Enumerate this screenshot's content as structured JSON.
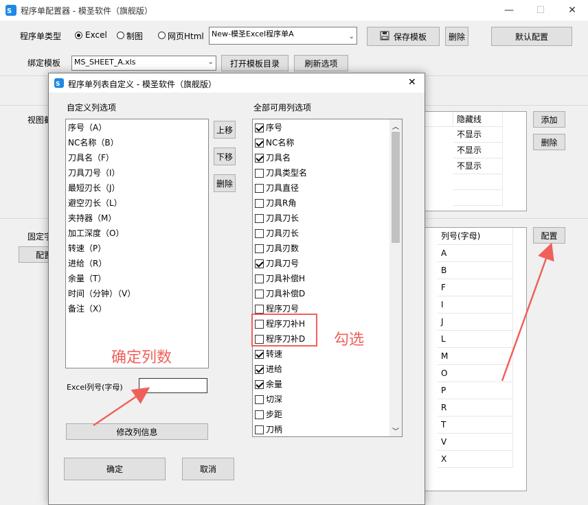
{
  "main_window": {
    "title": "程序单配置器 - 模圣软件（旗舰版）",
    "controls": {
      "minimize": "—",
      "maximize": "☐",
      "close": "✕"
    },
    "type_label": "程序单类型",
    "radios": [
      {
        "label": "Excel",
        "checked": true
      },
      {
        "label": "制图",
        "checked": false
      },
      {
        "label": "网页Html",
        "checked": false
      }
    ],
    "program_combo": "New-模圣Excel程序单A",
    "save_template": "保存模板",
    "delete": "删除",
    "default_config": "默认配置",
    "bind_template_label": "绑定模板",
    "template_combo": "MS_SHEET_A.xls",
    "open_template_dir": "打开模板目录",
    "refresh_options": "刷新选项",
    "view_label": "视图截",
    "fixed_label": "固定字",
    "config_partial": "配置",
    "view_grid": {
      "header": "隐藏线",
      "rows": [
        "不显示",
        "不显示",
        "不显示"
      ]
    },
    "add_button": "添加",
    "delete_button2": "删除",
    "config_button": "配置",
    "col_grid": {
      "header": "列号(字母)",
      "rows": [
        "A",
        "B",
        "F",
        "I",
        "J",
        "L",
        "M",
        "O",
        "P",
        "R",
        "T",
        "V",
        "X"
      ]
    }
  },
  "dialog": {
    "title": "程序单列表自定义 - 模圣软件（旗舰版）",
    "close": "✕",
    "custom_label": "自定义列选项",
    "custom_items": [
      "序号（A）",
      "NC名称（B）",
      "刀具名（F）",
      "刀具刀号（I）",
      "最短刃长（J）",
      "避空刃长（L）",
      "夹持器（M）",
      "加工深度（O）",
      "转速（P）",
      "进给（R）",
      "余量（T）",
      "时间（分钟）（V）",
      "备注（X）"
    ],
    "move_up": "上移",
    "move_down": "下移",
    "delete": "删除",
    "all_label": "全部可用列选项",
    "all_items": [
      {
        "label": "序号",
        "checked": true
      },
      {
        "label": "NC名称",
        "checked": true
      },
      {
        "label": "刀具名",
        "checked": true
      },
      {
        "label": "刀具类型名",
        "checked": false
      },
      {
        "label": "刀具直径",
        "checked": false
      },
      {
        "label": "刀具R角",
        "checked": false
      },
      {
        "label": "刀具刀长",
        "checked": false
      },
      {
        "label": "刀具刃长",
        "checked": false
      },
      {
        "label": "刀具刃数",
        "checked": false
      },
      {
        "label": "刀具刀号",
        "checked": true
      },
      {
        "label": "刀具补偿H",
        "checked": false
      },
      {
        "label": "刀具补偿D",
        "checked": false
      },
      {
        "label": "程序刀号",
        "checked": false
      },
      {
        "label": "程序刀补H",
        "checked": false
      },
      {
        "label": "程序刀补D",
        "checked": false
      },
      {
        "label": "转速",
        "checked": true
      },
      {
        "label": "进给",
        "checked": true
      },
      {
        "label": "余量",
        "checked": true
      },
      {
        "label": "切深",
        "checked": false
      },
      {
        "label": "步距",
        "checked": false
      },
      {
        "label": "刀柄",
        "checked": false
      }
    ],
    "excel_col_label": "Excel列号(字母)",
    "excel_col_value": "",
    "modify_button": "修改列信息",
    "ok": "确定",
    "cancel": "取消"
  },
  "annotations": {
    "confirm_cols": "确定列数",
    "check": "勾选"
  },
  "colors": {
    "annotation": "#f0605a",
    "logo": "#1e88e5"
  }
}
